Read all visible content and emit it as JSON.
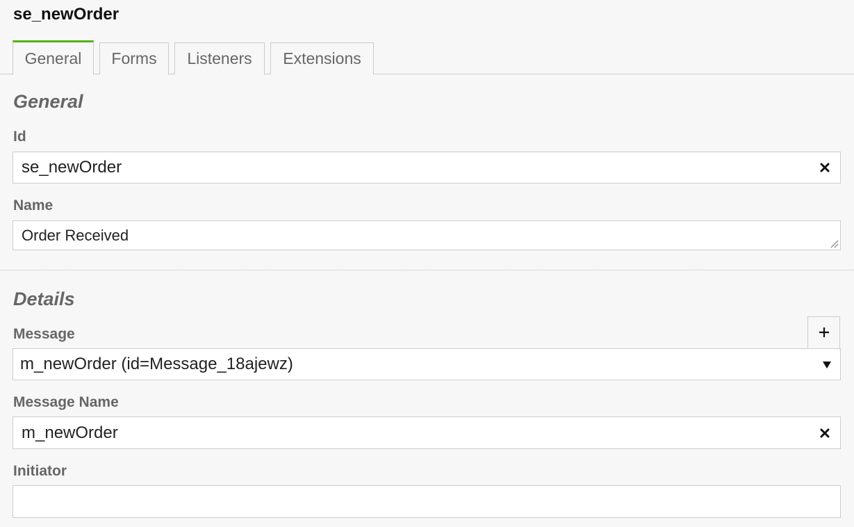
{
  "panel": {
    "title": "se_newOrder"
  },
  "tabs": [
    {
      "label": "General",
      "active": true
    },
    {
      "label": "Forms",
      "active": false
    },
    {
      "label": "Listeners",
      "active": false
    },
    {
      "label": "Extensions",
      "active": false
    }
  ],
  "general_group": {
    "title": "General",
    "id_label": "Id",
    "id_value": "se_newOrder",
    "name_label": "Name",
    "name_value": "Order Received"
  },
  "details_group": {
    "title": "Details",
    "message_label": "Message",
    "message_selected": "m_newOrder (id=Message_18ajewz)",
    "message_name_label": "Message Name",
    "message_name_value": "m_newOrder",
    "initiator_label": "Initiator",
    "initiator_value": ""
  },
  "colors": {
    "active_tab_accent": "#52b415",
    "background": "#f7f7f7",
    "label_text": "#666666"
  },
  "icons": {
    "clear": "close-icon",
    "add": "plus-icon",
    "dropdown": "caret-down-icon",
    "resize": "resize-grip-icon"
  }
}
